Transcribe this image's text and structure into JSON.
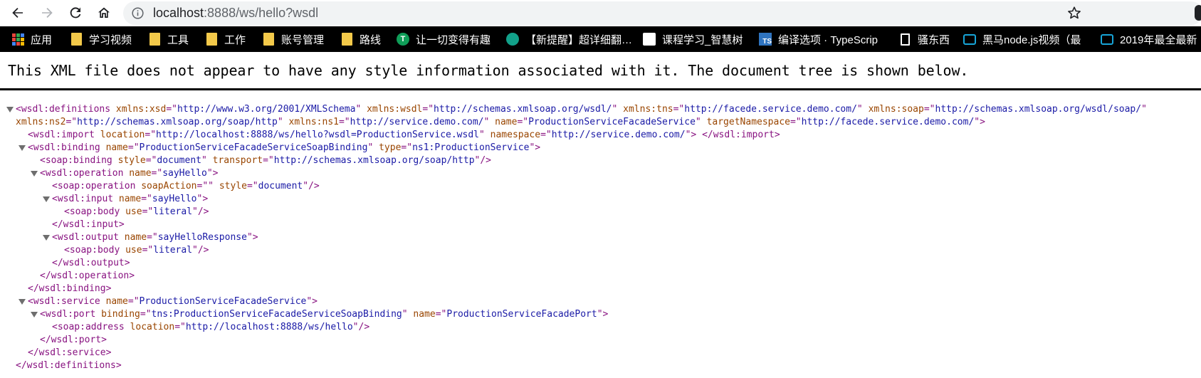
{
  "browser": {
    "url_host": "localhost",
    "url_path": ":8888/ws/hello?wsdl"
  },
  "bookmarks": [
    {
      "label": "应用",
      "icon": "apps-grid-icon"
    },
    {
      "label": "学习视频",
      "icon": "folder-icon"
    },
    {
      "label": "工具",
      "icon": "folder-icon"
    },
    {
      "label": "工作",
      "icon": "folder-icon"
    },
    {
      "label": "账号管理",
      "icon": "folder-icon"
    },
    {
      "label": "路线",
      "icon": "folder-icon"
    },
    {
      "label": "让一切变得有趣",
      "icon": "green-t-icon"
    },
    {
      "label": "【新提醒】超详细翻…",
      "icon": "search-circle-icon"
    },
    {
      "label": "课程学习_智慧树",
      "icon": "wave-icon"
    },
    {
      "label": "编译选项 · TypeScrip",
      "icon": "typescript-icon"
    },
    {
      "label": "骚东西",
      "icon": "document-icon"
    },
    {
      "label": "黑马node.js视频（最",
      "icon": "bilibili-tv-icon"
    },
    {
      "label": "2019年最全最新",
      "icon": "bilibili-tv-icon"
    }
  ],
  "viewer": {
    "banner": "This XML file does not appear to have any style information associated with it. The document tree is shown below.",
    "colors": {
      "tag": "#881280",
      "attr_name": "#994500",
      "attr_value": "#1a1aa6"
    },
    "lines": [
      {
        "indent": 0,
        "toggle": true,
        "parts": [
          [
            "t",
            "<wsdl:definitions "
          ],
          [
            "n",
            "xmlns:xsd"
          ],
          [
            "t",
            "=\""
          ],
          [
            "v",
            "http://www.w3.org/2001/XMLSchema"
          ],
          [
            "t",
            "\" "
          ],
          [
            "n",
            "xmlns:wsdl"
          ],
          [
            "t",
            "=\""
          ],
          [
            "v",
            "http://schemas.xmlsoap.org/wsdl/"
          ],
          [
            "t",
            "\" "
          ],
          [
            "n",
            "xmlns:tns"
          ],
          [
            "t",
            "=\""
          ],
          [
            "v",
            "http://facede.service.demo.com/"
          ],
          [
            "t",
            "\" "
          ],
          [
            "n",
            "xmlns:soap"
          ],
          [
            "t",
            "=\""
          ],
          [
            "v",
            "http://schemas.xmlsoap.org/wsdl/soap/"
          ],
          [
            "t",
            "\""
          ]
        ]
      },
      {
        "indent": 0,
        "toggle": false,
        "parts": [
          [
            "n",
            "xmlns:ns2"
          ],
          [
            "t",
            "=\""
          ],
          [
            "v",
            "http://schemas.xmlsoap.org/soap/http"
          ],
          [
            "t",
            "\" "
          ],
          [
            "n",
            "xmlns:ns1"
          ],
          [
            "t",
            "=\""
          ],
          [
            "v",
            "http://service.demo.com/"
          ],
          [
            "t",
            "\" "
          ],
          [
            "n",
            "name"
          ],
          [
            "t",
            "=\""
          ],
          [
            "v",
            "ProductionServiceFacadeService"
          ],
          [
            "t",
            "\" "
          ],
          [
            "n",
            "targetNamespace"
          ],
          [
            "t",
            "=\""
          ],
          [
            "v",
            "http://facede.service.demo.com/"
          ],
          [
            "t",
            "\">"
          ]
        ]
      },
      {
        "indent": 1,
        "toggle": false,
        "parts": [
          [
            "t",
            "<wsdl:import "
          ],
          [
            "n",
            "location"
          ],
          [
            "t",
            "=\""
          ],
          [
            "v",
            "http://localhost:8888/ws/hello?wsdl=ProductionService.wsdl"
          ],
          [
            "t",
            "\" "
          ],
          [
            "n",
            "namespace"
          ],
          [
            "t",
            "=\""
          ],
          [
            "v",
            "http://service.demo.com/"
          ],
          [
            "t",
            "\"> </wsdl:import>"
          ]
        ]
      },
      {
        "indent": 1,
        "toggle": true,
        "parts": [
          [
            "t",
            "<wsdl:binding "
          ],
          [
            "n",
            "name"
          ],
          [
            "t",
            "=\""
          ],
          [
            "v",
            "ProductionServiceFacadeServiceSoapBinding"
          ],
          [
            "t",
            "\" "
          ],
          [
            "n",
            "type"
          ],
          [
            "t",
            "=\""
          ],
          [
            "v",
            "ns1:ProductionService"
          ],
          [
            "t",
            "\">"
          ]
        ]
      },
      {
        "indent": 2,
        "toggle": false,
        "parts": [
          [
            "t",
            "<soap:binding "
          ],
          [
            "n",
            "style"
          ],
          [
            "t",
            "=\""
          ],
          [
            "v",
            "document"
          ],
          [
            "t",
            "\" "
          ],
          [
            "n",
            "transport"
          ],
          [
            "t",
            "=\""
          ],
          [
            "v",
            "http://schemas.xmlsoap.org/soap/http"
          ],
          [
            "t",
            "\"/>"
          ]
        ]
      },
      {
        "indent": 2,
        "toggle": true,
        "parts": [
          [
            "t",
            "<wsdl:operation "
          ],
          [
            "n",
            "name"
          ],
          [
            "t",
            "=\""
          ],
          [
            "v",
            "sayHello"
          ],
          [
            "t",
            "\">"
          ]
        ]
      },
      {
        "indent": 3,
        "toggle": false,
        "parts": [
          [
            "t",
            "<soap:operation "
          ],
          [
            "n",
            "soapAction"
          ],
          [
            "t",
            "=\"\" "
          ],
          [
            "n",
            "style"
          ],
          [
            "t",
            "=\""
          ],
          [
            "v",
            "document"
          ],
          [
            "t",
            "\"/>"
          ]
        ]
      },
      {
        "indent": 3,
        "toggle": true,
        "parts": [
          [
            "t",
            "<wsdl:input "
          ],
          [
            "n",
            "name"
          ],
          [
            "t",
            "=\""
          ],
          [
            "v",
            "sayHello"
          ],
          [
            "t",
            "\">"
          ]
        ]
      },
      {
        "indent": 4,
        "toggle": false,
        "parts": [
          [
            "t",
            "<soap:body "
          ],
          [
            "n",
            "use"
          ],
          [
            "t",
            "=\""
          ],
          [
            "v",
            "literal"
          ],
          [
            "t",
            "\"/>"
          ]
        ]
      },
      {
        "indent": 3,
        "toggle": false,
        "parts": [
          [
            "t",
            "</wsdl:input>"
          ]
        ]
      },
      {
        "indent": 3,
        "toggle": true,
        "parts": [
          [
            "t",
            "<wsdl:output "
          ],
          [
            "n",
            "name"
          ],
          [
            "t",
            "=\""
          ],
          [
            "v",
            "sayHelloResponse"
          ],
          [
            "t",
            "\">"
          ]
        ]
      },
      {
        "indent": 4,
        "toggle": false,
        "parts": [
          [
            "t",
            "<soap:body "
          ],
          [
            "n",
            "use"
          ],
          [
            "t",
            "=\""
          ],
          [
            "v",
            "literal"
          ],
          [
            "t",
            "\"/>"
          ]
        ]
      },
      {
        "indent": 3,
        "toggle": false,
        "parts": [
          [
            "t",
            "</wsdl:output>"
          ]
        ]
      },
      {
        "indent": 2,
        "toggle": false,
        "parts": [
          [
            "t",
            "</wsdl:operation>"
          ]
        ]
      },
      {
        "indent": 1,
        "toggle": false,
        "parts": [
          [
            "t",
            "</wsdl:binding>"
          ]
        ]
      },
      {
        "indent": 1,
        "toggle": true,
        "parts": [
          [
            "t",
            "<wsdl:service "
          ],
          [
            "n",
            "name"
          ],
          [
            "t",
            "=\""
          ],
          [
            "v",
            "ProductionServiceFacadeService"
          ],
          [
            "t",
            "\">"
          ]
        ]
      },
      {
        "indent": 2,
        "toggle": true,
        "parts": [
          [
            "t",
            "<wsdl:port "
          ],
          [
            "n",
            "binding"
          ],
          [
            "t",
            "=\""
          ],
          [
            "v",
            "tns:ProductionServiceFacadeServiceSoapBinding"
          ],
          [
            "t",
            "\" "
          ],
          [
            "n",
            "name"
          ],
          [
            "t",
            "=\""
          ],
          [
            "v",
            "ProductionServiceFacadePort"
          ],
          [
            "t",
            "\">"
          ]
        ]
      },
      {
        "indent": 3,
        "toggle": false,
        "parts": [
          [
            "t",
            "<soap:address "
          ],
          [
            "n",
            "location"
          ],
          [
            "t",
            "=\""
          ],
          [
            "v",
            "http://localhost:8888/ws/hello"
          ],
          [
            "t",
            "\"/>"
          ]
        ]
      },
      {
        "indent": 2,
        "toggle": false,
        "parts": [
          [
            "t",
            "</wsdl:port>"
          ]
        ]
      },
      {
        "indent": 1,
        "toggle": false,
        "parts": [
          [
            "t",
            "</wsdl:service>"
          ]
        ]
      },
      {
        "indent": 0,
        "toggle": false,
        "parts": [
          [
            "t",
            "</wsdl:definitions>"
          ]
        ]
      }
    ]
  }
}
